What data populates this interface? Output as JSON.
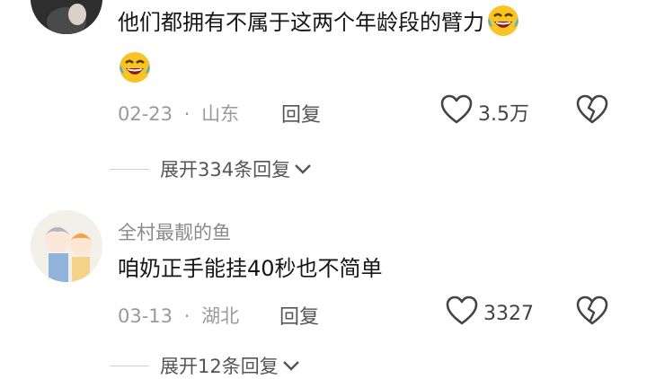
{
  "comments": [
    {
      "text": "他们都拥有不属于这两个年龄段的臂力",
      "date": "02-23",
      "location": "山东",
      "reply_label": "回复",
      "likes": "3.5万",
      "expand_label": "展开334条回复"
    },
    {
      "username": "全村最靓的鱼",
      "text": "咱奶正手能挂40秒也不简单",
      "date": "03-13",
      "location": "湖北",
      "reply_label": "回复",
      "likes": "3327",
      "expand_label": "展开12条回复"
    }
  ],
  "separator": "·",
  "icons": {
    "emoji": "laughing-tears-emoji",
    "like": "heart-outline-icon",
    "dislike": "broken-heart-icon",
    "chevron": "chevron-down-icon"
  },
  "colors": {
    "text": "#161616",
    "meta": "#9a9a9a",
    "username": "#8a8a8a",
    "emoji_yellow": "#f7c325"
  }
}
